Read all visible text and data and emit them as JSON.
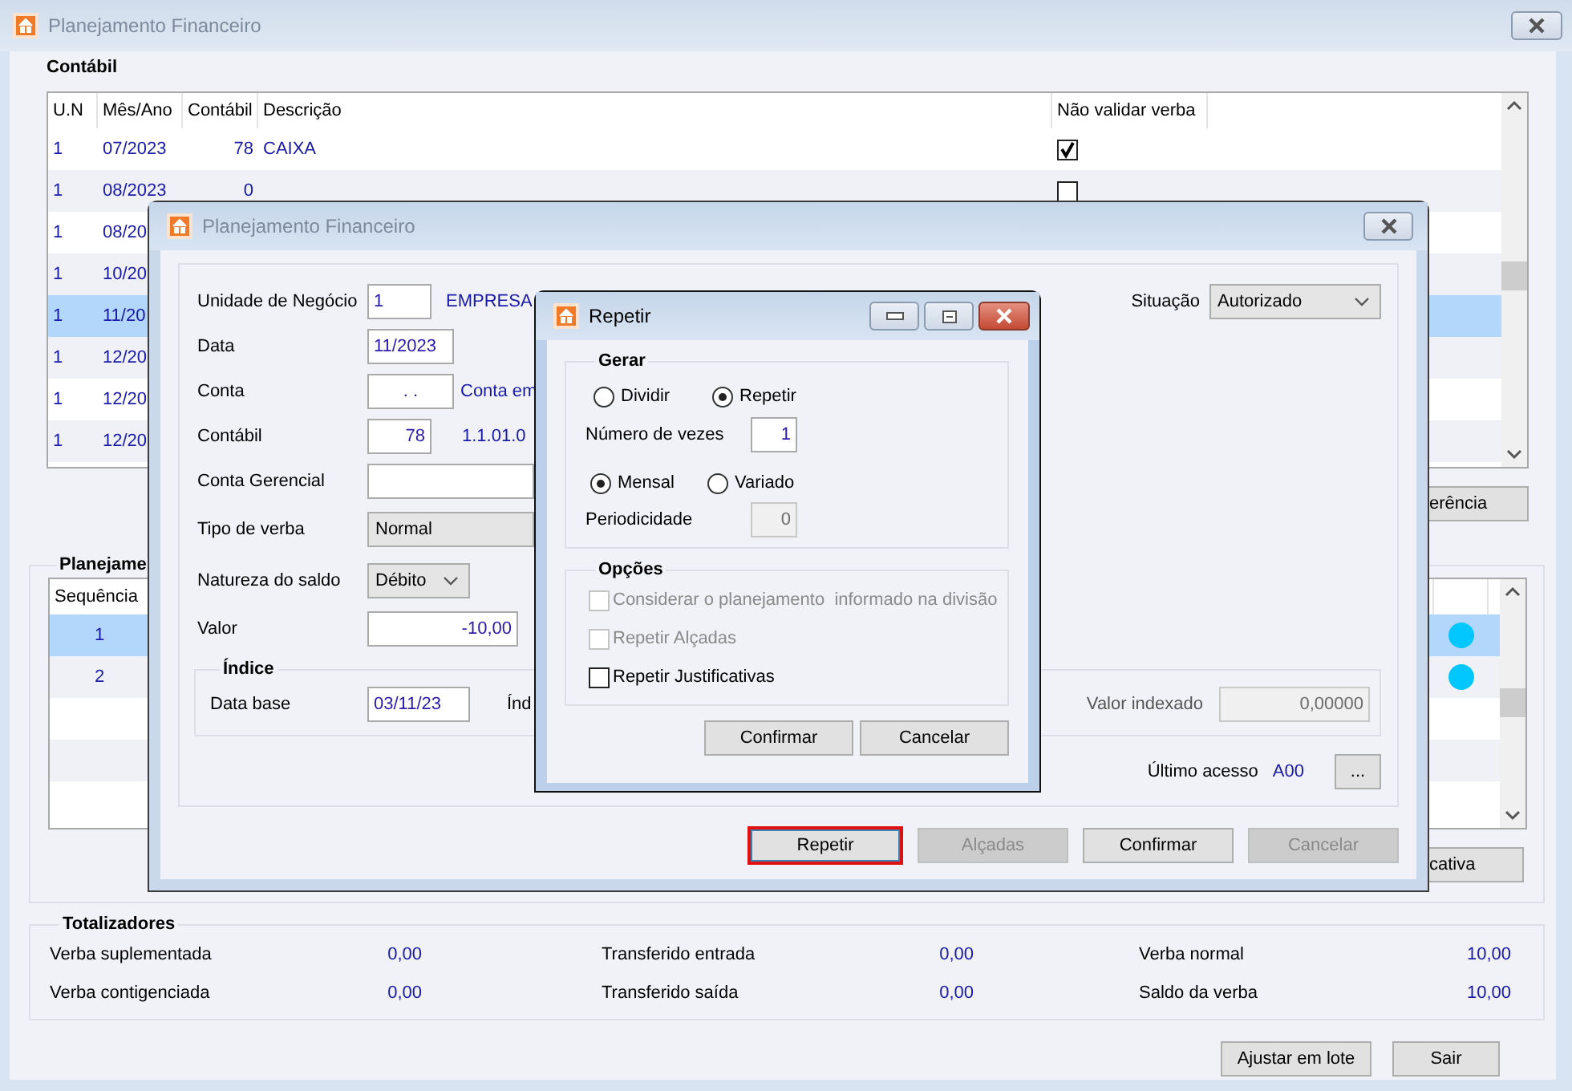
{
  "window": {
    "title": "Planejamento Financeiro"
  },
  "contabil": {
    "title": "Contábil",
    "columns": [
      "U.N",
      "Mês/Ano",
      "Contábil",
      "Descrição",
      "Não validar verba"
    ],
    "rows": [
      {
        "un": "1",
        "mes_ano": "07/2023",
        "contabil": "78",
        "descricao": "CAIXA",
        "nao_validar_verba": true,
        "selected": false
      },
      {
        "un": "1",
        "mes_ano": "08/2023",
        "contabil": "0",
        "nao_validar_verba": false,
        "selected": false
      },
      {
        "un": "1",
        "mes_ano": "08/20",
        "selected": false
      },
      {
        "un": "1",
        "mes_ano": "10/20",
        "selected": false
      },
      {
        "un": "1",
        "mes_ano": "11/20",
        "selected": true
      },
      {
        "un": "1",
        "mes_ano": "12/20",
        "selected": false
      },
      {
        "un": "1",
        "mes_ano": "12/20",
        "selected": false
      },
      {
        "un": "1",
        "mes_ano": "12/20",
        "selected": false
      }
    ],
    "button": "erência"
  },
  "planejamento": {
    "title": "Planejame",
    "columns": [
      "Sequência"
    ],
    "rows": [
      {
        "sequencia": "1",
        "color": "#00c8ff",
        "selected": true
      },
      {
        "sequencia": "2",
        "color": "#00c8ff",
        "selected": false
      }
    ],
    "button": "cativa"
  },
  "totalizadores": {
    "title": "Totalizadores",
    "items": [
      {
        "label": "Verba suplementada",
        "value": "0,00"
      },
      {
        "label": "Transferido entrada",
        "value": "0,00"
      },
      {
        "label": "Verba normal",
        "value": "10,00"
      },
      {
        "label": "Verba contigenciada",
        "value": "0,00"
      },
      {
        "label": "Transferido saída",
        "value": "0,00"
      },
      {
        "label": "Saldo da verba",
        "value": "10,00"
      }
    ]
  },
  "buttons": [
    "Ajustar em lote",
    "Sair"
  ],
  "dialog": {
    "title": "Planejamento Financeiro",
    "fields": [
      {
        "kind": "input",
        "label": "Unidade de Negócio",
        "value": "1",
        "note": "EMPRESA"
      },
      {
        "kind": "input",
        "label": "Data",
        "value": "11/2023"
      },
      {
        "kind": "input",
        "label": "Conta",
        "value": ". .",
        "note": "Conta em"
      },
      {
        "kind": "input",
        "label": "Contábil",
        "value": "78",
        "note": "1.1.01.0"
      },
      {
        "kind": "input",
        "label": "Conta Gerencial"
      },
      {
        "kind": "select",
        "label": "Tipo de verba",
        "value": "Normal"
      },
      {
        "kind": "select",
        "label": "Natureza do saldo",
        "value": "Débito"
      },
      {
        "kind": "input",
        "label": "Valor",
        "value": "-10,00"
      }
    ],
    "situacao": {
      "label": "Situação",
      "value": "Autorizado"
    },
    "indice": {
      "title": "Índice",
      "data_base_label": "Data base",
      "data_base": "03/11/23",
      "indice_label": "Índ",
      "valor_indexado_label": "Valor indexado",
      "valor_indexado": "0,00000"
    },
    "ultimo_acesso": {
      "label": "Último acesso",
      "value": "A00",
      "button": "..."
    },
    "buttons": [
      {
        "label": "Repetir",
        "disabled": false,
        "highlighted": true
      },
      {
        "label": "Alçadas",
        "disabled": true,
        "highlighted": false
      },
      {
        "label": "Confirmar",
        "disabled": false,
        "highlighted": false
      },
      {
        "label": "Cancelar",
        "disabled": true,
        "highlighted": false
      }
    ]
  },
  "repetir": {
    "title": "Repetir",
    "gerar": {
      "title": "Gerar",
      "modes": [
        {
          "label": "Dividir",
          "selected": false
        },
        {
          "label": "Repetir",
          "selected": true
        }
      ],
      "vezes_label": "Número de vezes",
      "vezes": "1",
      "frequencias": [
        {
          "label": "Mensal",
          "selected": true
        },
        {
          "label": "Variado",
          "selected": false
        }
      ],
      "periodicidade_label": "Periodicidade",
      "periodicidade": "0",
      "periodicidade_disabled": true
    },
    "opcoes": {
      "title": "Opções",
      "items": [
        {
          "label": "Considerar o planejamento  informado na divisão",
          "checked": false,
          "disabled": true
        },
        {
          "label": "Repetir Alçadas",
          "checked": false,
          "disabled": true
        },
        {
          "label": "Repetir Justificativas",
          "checked": false,
          "disabled": false
        }
      ]
    },
    "buttons": [
      "Confirmar",
      "Cancelar"
    ]
  }
}
